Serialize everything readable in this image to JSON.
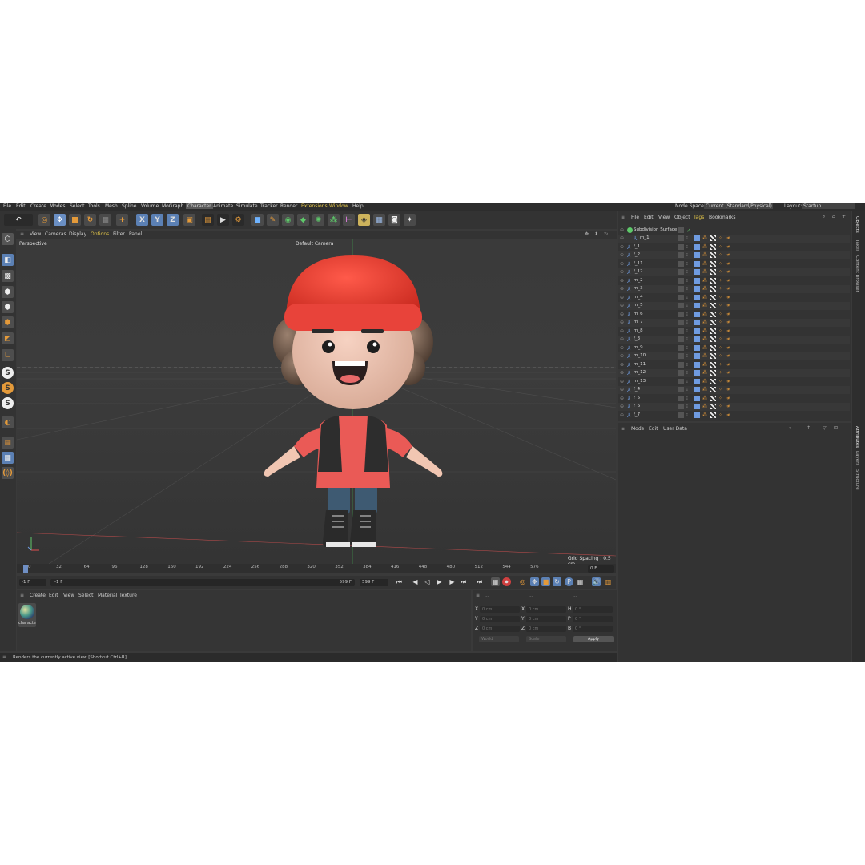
{
  "menubar": {
    "items": [
      "File",
      "Edit",
      "Create",
      "Modes",
      "Select",
      "Tools",
      "Mesh",
      "Spline",
      "Volume",
      "MoGraph",
      "Character",
      "Animate",
      "Simulate",
      "Tracker",
      "Render",
      "Extensions",
      "Window",
      "Help"
    ],
    "node_space_label": "Node Space:",
    "node_space_value": "Current (Standard/Physical)",
    "layout_label": "Layout:",
    "layout_value": "Startup"
  },
  "toolbar": {
    "axis_x": "X",
    "axis_y": "Y",
    "axis_z": "Z"
  },
  "leftbar": {
    "s1": "S",
    "s2": "S",
    "s3": "S"
  },
  "viewport_menu": [
    "View",
    "Cameras",
    "Display",
    "Options",
    "Filter",
    "Panel"
  ],
  "viewport": {
    "mode": "Perspective",
    "camera": "Default Camera",
    "grid_spacing": "Grid Spacing : 0.5 cm"
  },
  "timeline": {
    "ticks": [
      "0",
      "32",
      "64",
      "96",
      "128",
      "160",
      "192",
      "224",
      "256",
      "288",
      "320",
      "352",
      "384",
      "416",
      "448",
      "480",
      "512",
      "544",
      "576"
    ],
    "current_frame": "0 F"
  },
  "transport": {
    "start": "-1 F",
    "min": "-1 F",
    "max_inner": "599 F",
    "end": "599 F"
  },
  "material_panel": {
    "menu": [
      "Create",
      "Edit",
      "View",
      "Select",
      "Material",
      "Texture"
    ],
    "material_name": "characte"
  },
  "coord_panel": {
    "col_headers": [
      "...",
      "...",
      "..."
    ],
    "labels_pos": [
      "X",
      "Y",
      "Z"
    ],
    "labels_size": [
      "X",
      "Y",
      "Z"
    ],
    "labels_rot": [
      "H",
      "P",
      "B"
    ],
    "pos_values": [
      "0 cm",
      "0 cm",
      "0 cm"
    ],
    "size_values": [
      "0 cm",
      "0 cm",
      "0 cm"
    ],
    "rot_values": [
      "0 °",
      "0 °",
      "0 °"
    ],
    "coord_mode": "World",
    "scale_mode": "Scale",
    "apply": "Apply"
  },
  "status": {
    "text": "Renders the currently active view [Shortcut Ctrl+R]"
  },
  "objects": {
    "menu": [
      "File",
      "Edit",
      "View",
      "Object",
      "Tags",
      "Bookmarks"
    ],
    "root": "Subdivision Surface",
    "items": [
      "m_1",
      "f_1",
      "f_2",
      "f_11",
      "f_12",
      "m_2",
      "m_3",
      "m_4",
      "m_5",
      "m_6",
      "m_7",
      "m_8",
      "f_3",
      "m_9",
      "m_10",
      "m_11",
      "m_12",
      "m_13",
      "f_4",
      "f_5",
      "f_6",
      "f_7"
    ]
  },
  "attributes": {
    "menu": [
      "Mode",
      "Edit",
      "User Data"
    ]
  },
  "side_tabs": [
    "Objects",
    "Takes",
    "Content Browser",
    "Attributes",
    "Layers",
    "Structure"
  ],
  "colors": {
    "accent_yellow": "#e6c84a",
    "selected_blue": "#5b80b4",
    "hat_red": "#e8443a"
  }
}
